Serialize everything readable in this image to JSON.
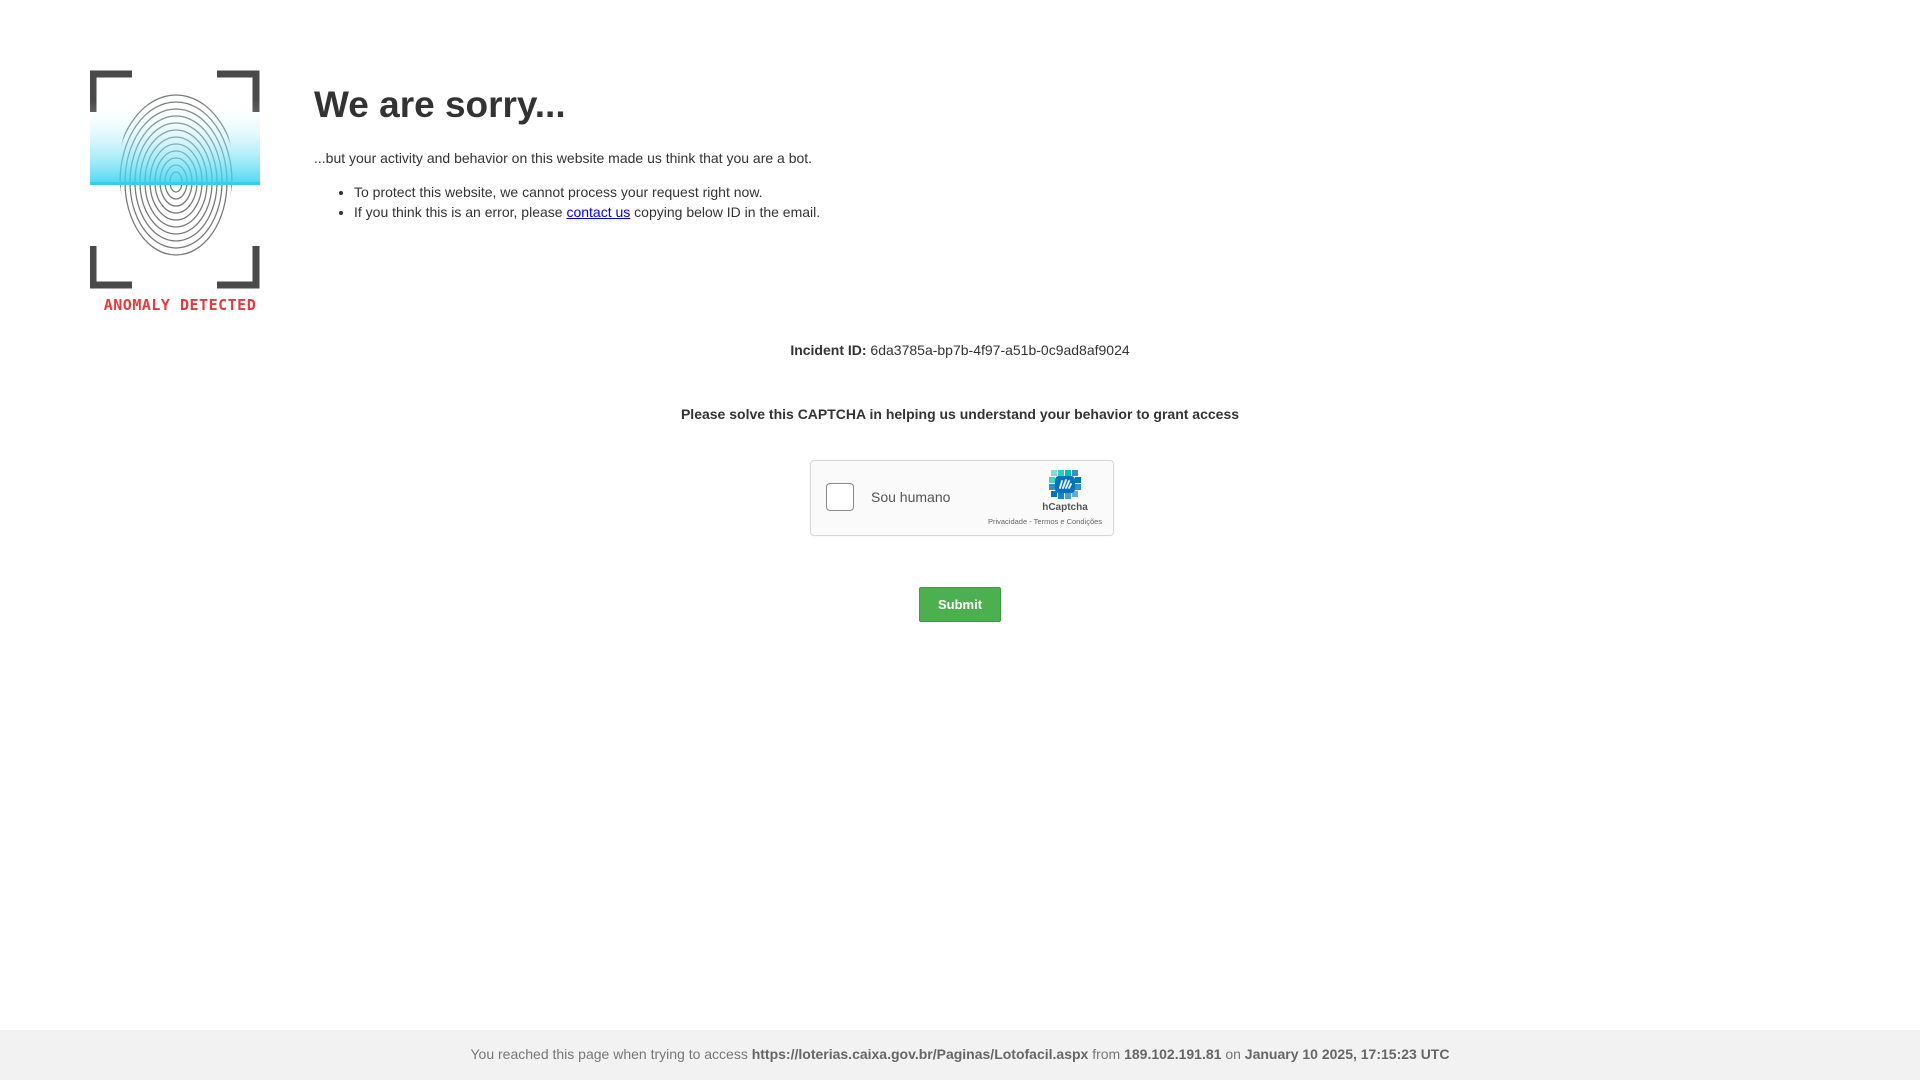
{
  "logo": {
    "caption": "ANOMALY DETECTED",
    "icon": "fingerprint-icon",
    "colors": {
      "frame": "#4a4a4a",
      "scan": "#2fd0f0",
      "caption": "#e8383d"
    }
  },
  "heading": {
    "title": "We are sorry...",
    "subtitle": "...but your activity and behavior on this website made us think that you are a bot."
  },
  "reasons": {
    "item1": "To protect this website, we cannot process your request right now.",
    "item2_before": "If you think this is an error, please ",
    "item2_link": "contact us",
    "item2_after": " copying below ID in the email."
  },
  "incident": {
    "label": "Incident ID:",
    "value": " 6da3785a-bp7b-4f97-a51b-0c9ad8af9024"
  },
  "captcha": {
    "prompt": "Please solve this CAPTCHA in helping us understand your behavior to grant access",
    "checkbox_label": "Sou humano",
    "brand": "hCaptcha",
    "privacy_link": "Privacidade",
    "separator": " - ",
    "terms_link": "Termos e Condições",
    "icon": "hcaptcha-logo-icon",
    "colors": {
      "brand": "#0074bf",
      "brand_light": "#00bfb3"
    }
  },
  "form": {
    "submit_label": "Submit",
    "submit_color": "#4caf50"
  },
  "footer": {
    "prefix": "You reached this page when trying to access ",
    "url": "https://loterias.caixa.gov.br/Paginas/Lotofacil.aspx",
    "from_label": " from ",
    "ip": "189.102.191.81",
    "on_label": " on ",
    "datetime": "January 10 2025, 17:15:23 UTC"
  }
}
